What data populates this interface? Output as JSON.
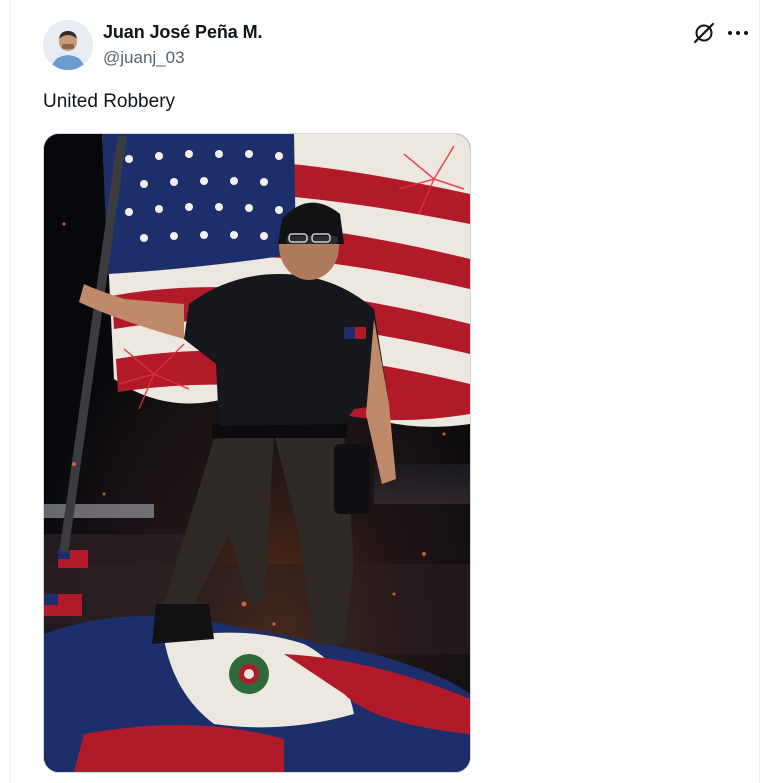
{
  "post": {
    "author_name": "Juan José Peña M.",
    "author_handle": "@juanj_03",
    "text": "United Robbery",
    "avatar_icon": "user-avatar",
    "grok_icon": "grok-icon",
    "more_icon": "more-options-icon"
  },
  "media": {
    "description_icon": "photo-umpire-on-flag",
    "colors": {
      "navy": "#1d2f6b",
      "red": "#b21a2a",
      "white": "#ece7df",
      "shirt": "#15171c",
      "pants": "#2f2a26"
    }
  }
}
